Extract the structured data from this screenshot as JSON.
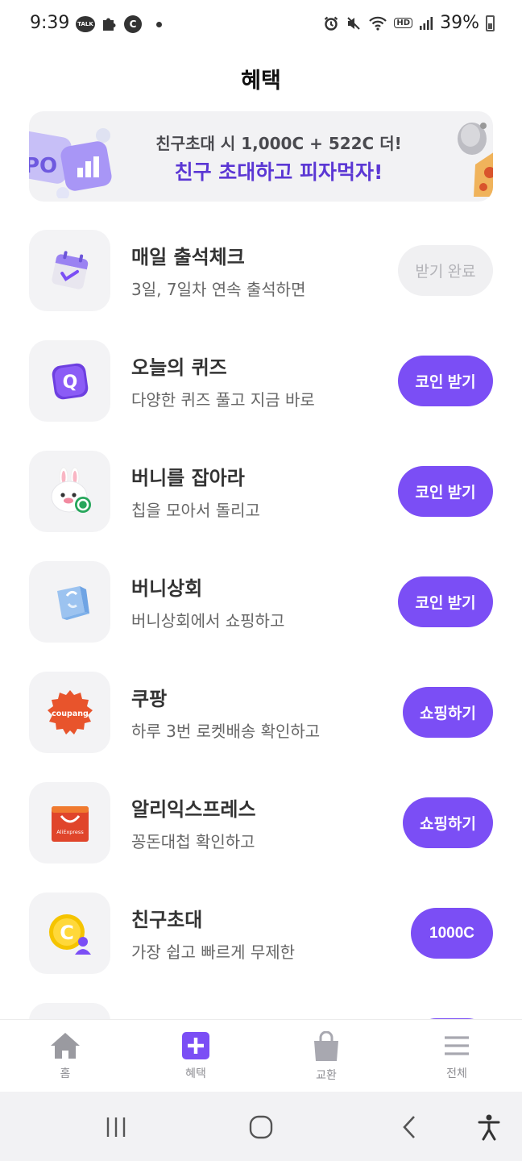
{
  "status_bar": {
    "time": "9:39",
    "talk_badge": "TALK",
    "c_badge": "C",
    "hd_badge": "HD",
    "battery": "39%"
  },
  "header": {
    "title": "혜택"
  },
  "banner": {
    "line1": "친구초대 시 1,000C + 522C 더!",
    "line2": "친구 초대하고 피자먹자!",
    "art_text": "PO"
  },
  "items": [
    {
      "title": "매일 출석체크",
      "subtitle": "3일, 7일차 연속 출석하면",
      "button": "받기 완료",
      "icon": "calendar-check-icon"
    },
    {
      "title": "오늘의 퀴즈",
      "subtitle": "다양한 퀴즈 풀고 지금 바로",
      "button": "코인 받기",
      "icon": "quiz-icon",
      "icon_text": "Q"
    },
    {
      "title": "버니를 잡아라",
      "subtitle": "칩을 모아서 돌리고",
      "button": "코인 받기",
      "icon": "bunny-icon"
    },
    {
      "title": "버니상회",
      "subtitle": "버니상회에서 쇼핑하고",
      "button": "코인 받기",
      "icon": "shopping-bag-icon"
    },
    {
      "title": "쿠팡",
      "subtitle": "하루 3번 로켓배송 확인하고",
      "button": "쇼핑하기",
      "icon": "coupang-logo",
      "icon_text": "coupang"
    },
    {
      "title": "알리익스프레스",
      "subtitle": "꽁돈대첩 확인하고",
      "button": "쇼핑하기",
      "icon": "aliexpress-logo",
      "icon_text": "AliExpress"
    },
    {
      "title": "친구초대",
      "subtitle": "가장 쉽고 빠르게 무제한",
      "button": "1000C",
      "icon": "coin-friend-icon",
      "icon_text": "C"
    }
  ],
  "bottom_nav": [
    {
      "label": "홈",
      "icon": "home-icon"
    },
    {
      "label": "혜택",
      "icon": "plus-square-icon"
    },
    {
      "label": "교환",
      "icon": "shopping-bag-icon"
    },
    {
      "label": "전체",
      "icon": "menu-icon"
    }
  ],
  "colors": {
    "accent": "#7b4ef5",
    "banner_text": "#5b37d4",
    "icon_box": "#f3f3f5"
  }
}
